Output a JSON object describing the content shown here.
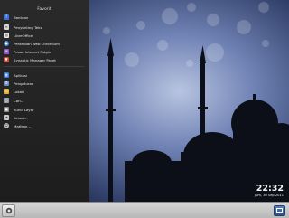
{
  "menu": {
    "title": "Favorit",
    "favorites": [
      {
        "label": "Bantuan",
        "icon": "help-icon",
        "color": "#3b6fd4"
      },
      {
        "label": "Penyunting Teks",
        "icon": "text-editor-icon",
        "color": "#d8d8d8"
      },
      {
        "label": "LibreOffice",
        "icon": "libreoffice-icon",
        "color": "#e8e8e8"
      },
      {
        "label": "Peramban Web Chromium",
        "icon": "chromium-icon",
        "color": "#4a90d9"
      },
      {
        "label": "Pesan Internet Pidgin",
        "icon": "pidgin-icon",
        "color": "#8b5cc4"
      },
      {
        "label": "Synaptic Manager Paket",
        "icon": "synaptic-icon",
        "color": "#c94a3a"
      }
    ],
    "system": [
      {
        "label": "Aplikasi",
        "icon": "applications-icon",
        "color": "#3a7bd5"
      },
      {
        "label": "Pengaturan",
        "icon": "settings-icon",
        "color": "#6a8fbf"
      },
      {
        "label": "Lokasi",
        "icon": "folder-icon",
        "color": "#e0b040"
      },
      {
        "label": "Cari...",
        "icon": "search-icon",
        "color": "#9aa4b0"
      },
      {
        "label": "Kunci Layar",
        "icon": "lock-icon",
        "color": "#8a8a8a"
      },
      {
        "label": "Keluar...",
        "icon": "logout-icon",
        "color": "#c9c9c9"
      },
      {
        "label": "Matikan...",
        "icon": "power-icon",
        "color": "#bfbfbf"
      }
    ]
  },
  "clock": {
    "time": "22:32",
    "date": "Jum, 30 Sep 2011"
  },
  "taskbar": {
    "start_icon": "start-menu-icon",
    "tray_icon": "show-desktop-icon"
  }
}
